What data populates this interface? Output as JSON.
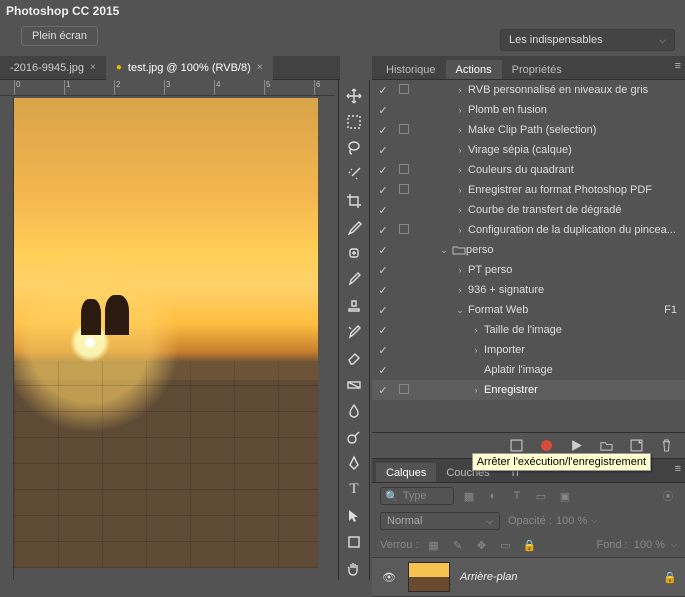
{
  "app": {
    "title": "Photoshop CC 2015"
  },
  "toolbar": {
    "fullscreen": "Plein écran"
  },
  "workspace": {
    "selected": "Les indispensables"
  },
  "document_tabs": [
    {
      "label": "-2016-9945.jpg",
      "modified": false,
      "active": false
    },
    {
      "label": "test.jpg @ 100% (RVB/8)",
      "modified": true,
      "active": true
    }
  ],
  "panels": {
    "actions_group": {
      "tabs": [
        "Historique",
        "Actions",
        "Propriétés"
      ],
      "active": "Actions"
    },
    "layers_group": {
      "tabs": [
        "Calques",
        "Couches",
        "Tracés"
      ],
      "active": "Calques"
    }
  },
  "actions": {
    "rows": [
      {
        "chk": true,
        "dlg": true,
        "exp": "›",
        "depth": 2,
        "label": "RVB personnalisé en niveaux de gris"
      },
      {
        "chk": true,
        "dlg": false,
        "exp": "›",
        "depth": 2,
        "label": "Plomb en fusion"
      },
      {
        "chk": true,
        "dlg": true,
        "exp": "›",
        "depth": 2,
        "label": "Make Clip Path (selection)"
      },
      {
        "chk": true,
        "dlg": false,
        "exp": "›",
        "depth": 2,
        "label": "Virage sépia (calque)"
      },
      {
        "chk": true,
        "dlg": true,
        "exp": "›",
        "depth": 2,
        "label": "Couleurs du quadrant"
      },
      {
        "chk": true,
        "dlg": true,
        "exp": "›",
        "depth": 2,
        "label": "Enregistrer au format Photoshop PDF"
      },
      {
        "chk": true,
        "dlg": false,
        "exp": "›",
        "depth": 2,
        "label": "Courbe de transfert de dégradé"
      },
      {
        "chk": true,
        "dlg": true,
        "exp": "›",
        "depth": 2,
        "label": "Configuration de la duplication du pincea..."
      },
      {
        "chk": true,
        "dlg": false,
        "exp": "⌄",
        "depth": 1,
        "label": "perso",
        "folder": true
      },
      {
        "chk": true,
        "dlg": false,
        "exp": "›",
        "depth": 2,
        "label": "PT perso"
      },
      {
        "chk": true,
        "dlg": false,
        "exp": "›",
        "depth": 2,
        "label": "936 + signature"
      },
      {
        "chk": true,
        "dlg": false,
        "exp": "⌄",
        "depth": 2,
        "label": "Format Web",
        "shortcut": "F1"
      },
      {
        "chk": true,
        "dlg": false,
        "exp": "›",
        "depth": 3,
        "label": "Taille de l'image"
      },
      {
        "chk": true,
        "dlg": false,
        "exp": "›",
        "depth": 3,
        "label": "Importer"
      },
      {
        "chk": true,
        "dlg": false,
        "exp": "",
        "depth": 3,
        "label": "Aplatir l'image"
      },
      {
        "chk": true,
        "dlg": true,
        "exp": "›",
        "depth": 3,
        "label": "Enregistrer",
        "selected": true
      }
    ],
    "footer_tooltip": "Arrêter l'exécution/l'enregistrement"
  },
  "layers": {
    "search_label": "Type",
    "blend_mode": "Normal",
    "opacity_label": "Opacité :",
    "opacity_value": "100 %",
    "lock_label": "Verrou :",
    "fill_label": "Fond :",
    "fill_value": "100 %",
    "layer_name": "Arrière-plan"
  }
}
